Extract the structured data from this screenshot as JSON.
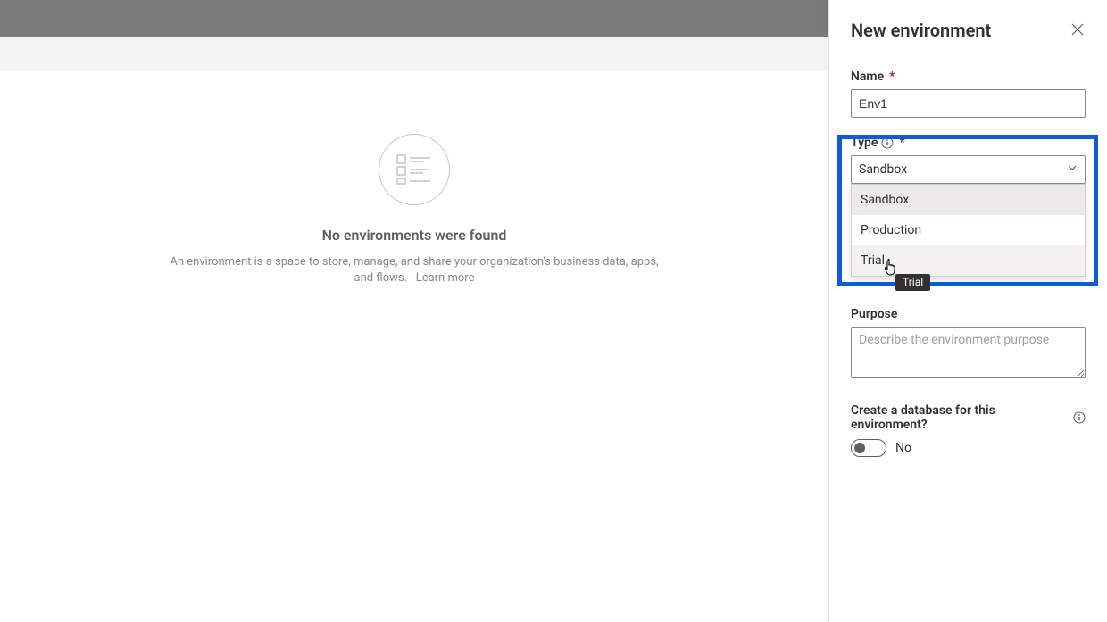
{
  "main": {
    "empty": {
      "title": "No environments were found",
      "description": "An environment is a space to store, manage, and share your organization's business data, apps, and flows.",
      "learn_more": "Learn more"
    }
  },
  "panel": {
    "title": "New environment",
    "name": {
      "label": "Name",
      "value": "Env1"
    },
    "type": {
      "label": "Type",
      "selected": "Sandbox",
      "options": [
        "Sandbox",
        "Production",
        "Trial"
      ],
      "tooltip": "Trial"
    },
    "purpose": {
      "label": "Purpose",
      "placeholder": "Describe the environment purpose"
    },
    "database": {
      "label": "Create a database for this environment?",
      "value_label": "No"
    }
  },
  "colors": {
    "highlight": "#0b5cd6",
    "required": "#a4262c"
  }
}
